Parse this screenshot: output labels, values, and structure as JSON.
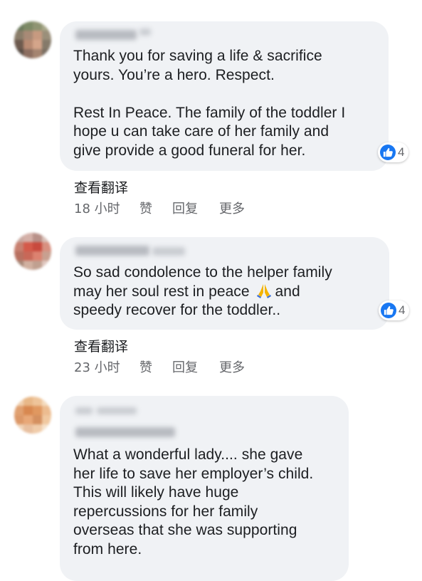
{
  "comments": [
    {
      "paragraphs": [
        "Thank you for saving a life & sacrifice yours. You’re a hero. Respect.",
        "Rest In Peace. The family of the toddler I hope u can take care of her family and give provide a good funeral for her."
      ],
      "lines_p1": [
        "Thank you for saving a life & sacrifice",
        "yours. You’re a hero. Respect."
      ],
      "lines_p2": [
        "Rest In Peace. The family of the toddler I",
        "hope u can take care of her family and",
        "give provide a good funeral for her."
      ],
      "reaction_count": "4",
      "see_translation": "查看翻译",
      "time": "18 小时",
      "like_label": "赞",
      "reply_label": "回复",
      "more_label": "更多"
    },
    {
      "line1": "So sad condolence to the helper family",
      "line2_before": "may her soul rest in peace",
      "line2_after": "and",
      "line3": "speedy recover for the toddler..",
      "reaction_count": "4",
      "see_translation": "查看翻译",
      "time": "23 小时",
      "like_label": "赞",
      "reply_label": "回复",
      "more_label": "更多"
    },
    {
      "lines": [
        "What a wonderful lady.... she gave",
        "her life to save her employer’s child.",
        "This will likely have huge",
        "repercussions for her family",
        "overseas that she was supporting",
        "from here."
      ]
    }
  ],
  "icons": {
    "like": "thumbs-up-icon",
    "emoji": "folded-hands-emoji"
  },
  "colors": {
    "bubble": "#f0f2f5",
    "like_blue": "#1877f2",
    "secondary_text": "#65676b",
    "primary_text": "#1c1e21"
  }
}
